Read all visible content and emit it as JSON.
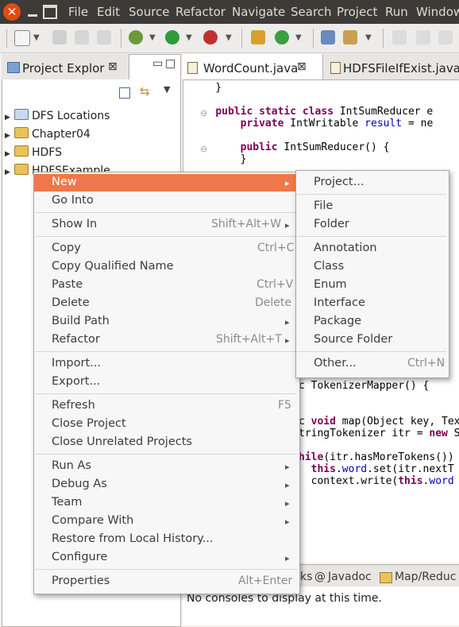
{
  "menubar": {
    "items": [
      "File",
      "Edit",
      "Source",
      "Refactor",
      "Navigate",
      "Search",
      "Project",
      "Run",
      "Window"
    ]
  },
  "project_explorer": {
    "title": "Project Explor",
    "tree": [
      {
        "label": "DFS Locations"
      },
      {
        "label": "Chapter04"
      },
      {
        "label": "HDFS"
      },
      {
        "label": "HDFSExample"
      }
    ]
  },
  "editor": {
    "tabs": [
      "WordCount.java",
      "HDFSFileIfExist.java"
    ],
    "code_lines": [
      {
        "text": "    }"
      },
      {
        "text": ""
      },
      {
        "text": "    public static class IntSumReducer e"
      },
      {
        "text": "        private IntWritable result = ne"
      },
      {
        "text": ""
      },
      {
        "text": "        public IntSumReducer() {"
      },
      {
        "text": "        }"
      }
    ],
    "code_lines_lower": [
      {
        "text": "c TokenizerMapper() {"
      },
      {
        "text": ""
      },
      {
        "text": "c void map(Object key, Tex"
      },
      {
        "text": "tringTokenizer itr = new S"
      },
      {
        "text": ""
      },
      {
        "text": "hile(itr.hasMoreTokens())"
      },
      {
        "text": "  this.word.set(itr.nextT"
      },
      {
        "text": "  context.write(this.word"
      }
    ]
  },
  "console": {
    "tabs": [
      "ks",
      "Javadoc",
      "Map/Reduc"
    ],
    "message": "No consoles to display at this time."
  },
  "context_menu": {
    "items": [
      {
        "label": "New",
        "shortcut": "",
        "submenu": true
      },
      {
        "label": "Go Into",
        "shortcut": ""
      },
      {
        "label": "Show In",
        "shortcut": "Shift+Alt+W",
        "submenu": true
      },
      {
        "label": "Copy",
        "shortcut": "Ctrl+C"
      },
      {
        "label": "Copy Qualified Name",
        "shortcut": ""
      },
      {
        "label": "Paste",
        "shortcut": "Ctrl+V"
      },
      {
        "label": "Delete",
        "shortcut": "Delete"
      },
      {
        "label": "Build Path",
        "shortcut": "",
        "submenu": true
      },
      {
        "label": "Refactor",
        "shortcut": "Shift+Alt+T",
        "submenu": true
      },
      {
        "label": "Import...",
        "shortcut": ""
      },
      {
        "label": "Export...",
        "shortcut": ""
      },
      {
        "label": "Refresh",
        "shortcut": "F5"
      },
      {
        "label": "Close Project",
        "shortcut": ""
      },
      {
        "label": "Close Unrelated Projects",
        "shortcut": ""
      },
      {
        "label": "Run As",
        "shortcut": "",
        "submenu": true
      },
      {
        "label": "Debug As",
        "shortcut": "",
        "submenu": true
      },
      {
        "label": "Team",
        "shortcut": "",
        "submenu": true
      },
      {
        "label": "Compare With",
        "shortcut": "",
        "submenu": true
      },
      {
        "label": "Restore from Local History...",
        "shortcut": ""
      },
      {
        "label": "Configure",
        "shortcut": "",
        "submenu": true
      },
      {
        "label": "Properties",
        "shortcut": "Alt+Enter"
      }
    ]
  },
  "new_submenu": {
    "items": [
      {
        "label": "Project...",
        "shortcut": ""
      },
      {
        "label": "File",
        "shortcut": ""
      },
      {
        "label": "Folder",
        "shortcut": ""
      },
      {
        "label": "Annotation",
        "shortcut": ""
      },
      {
        "label": "Class",
        "shortcut": ""
      },
      {
        "label": "Enum",
        "shortcut": ""
      },
      {
        "label": "Interface",
        "shortcut": ""
      },
      {
        "label": "Package",
        "shortcut": ""
      },
      {
        "label": "Source Folder",
        "shortcut": ""
      },
      {
        "label": "Other...",
        "shortcut": "Ctrl+N"
      }
    ]
  },
  "colors": {
    "menubar_bg": "#3c3b37",
    "highlight": "#f0774a",
    "close_button": "#df4a16"
  },
  "icons": [
    "close-icon",
    "minimize-icon",
    "maximize-icon",
    "folder-icon",
    "java-file-icon",
    "submenu-arrow-icon"
  ]
}
